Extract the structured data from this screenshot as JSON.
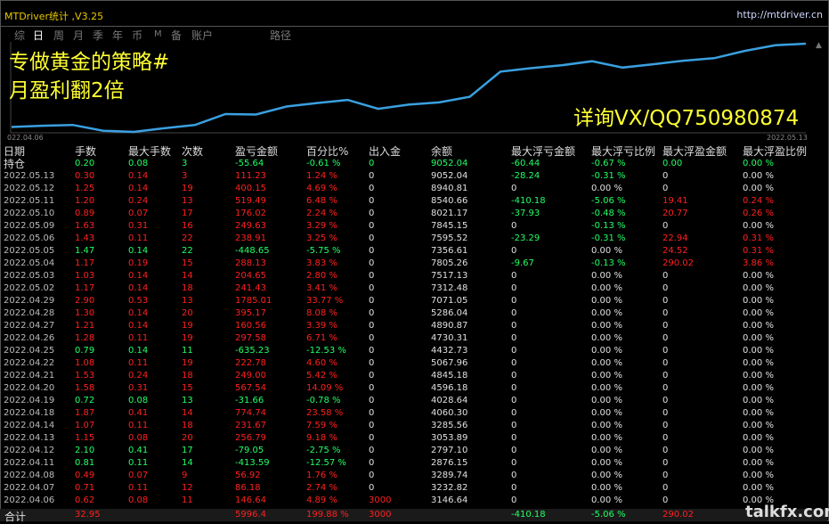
{
  "window": {
    "title": "MTDriver统计 ,V3.25",
    "url": "http://mtdriver.cn"
  },
  "tabs": [
    "综",
    "日",
    "周",
    "月",
    "季",
    "年",
    "币",
    "M",
    "备",
    "账户",
    "路径"
  ],
  "active_tab": "日",
  "overlay": {
    "line1": "专做黄金的策略#",
    "line2": "月盈利翻2倍",
    "line3": "详询VX/QQ750980874"
  },
  "chart_labels": {
    "start": "022.04.06",
    "end": "2022.05.13"
  },
  "chart_data": {
    "type": "line",
    "x": [
      "2022.04.06",
      "2022.04.07",
      "2022.04.08",
      "2022.04.11",
      "2022.04.12",
      "2022.04.13",
      "2022.04.14",
      "2022.04.18",
      "2022.04.19",
      "2022.04.20",
      "2022.04.21",
      "2022.04.22",
      "2022.04.25",
      "2022.04.26",
      "2022.04.27",
      "2022.04.28",
      "2022.04.29",
      "2022.05.02",
      "2022.05.03",
      "2022.05.04",
      "2022.05.05",
      "2022.05.06",
      "2022.05.09",
      "2022.05.10",
      "2022.05.11",
      "2022.05.12",
      "2022.05.13"
    ],
    "values": [
      3146.64,
      3232.82,
      3289.74,
      2876.15,
      2797.1,
      3053.89,
      3285.56,
      4060.3,
      4028.64,
      4596.18,
      4845.18,
      5067.96,
      4432.73,
      4730.31,
      4890.87,
      5286.04,
      7071.05,
      7312.48,
      7517.13,
      7805.26,
      7356.61,
      7595.52,
      7845.15,
      8021.17,
      8540.66,
      8940.81,
      9052.04
    ],
    "color": "#3aa0e0"
  },
  "columns": [
    "日期",
    "手数",
    "最大手数",
    "次数",
    "盈亏金额",
    "百分比%",
    "出入金",
    "余额",
    "最大浮亏金额",
    "最大浮亏比例",
    "最大浮盈金额",
    "最大浮盈比例"
  ],
  "holding": {
    "date": "持仓",
    "lots": "0.20",
    "maxlots": "0.08",
    "count": "3",
    "pnl": "-55.64",
    "pct": "-0.61 %",
    "io": "0",
    "bal": "9052.04",
    "mfl": "-60.44",
    "mflp": "-0.67 %",
    "mfp": "0.00",
    "mfpp": "0.00 %"
  },
  "rows": [
    {
      "date": "2022.05.13",
      "lots": "0.30",
      "maxlots": "0.14",
      "count": "3",
      "pnl": "111.23",
      "pct": "1.24 %",
      "io": "0",
      "bal": "9052.04",
      "mfl": "-28.24",
      "mflp": "-0.31 %",
      "mfp": "0",
      "mfpp": "0.00 %",
      "c": "r"
    },
    {
      "date": "2022.05.12",
      "lots": "1.25",
      "maxlots": "0.14",
      "count": "19",
      "pnl": "400.15",
      "pct": "4.69 %",
      "io": "0",
      "bal": "8940.81",
      "mfl": "0",
      "mflp": "0.00 %",
      "mfp": "0",
      "mfpp": "0.00 %",
      "c": "r"
    },
    {
      "date": "2022.05.11",
      "lots": "1.20",
      "maxlots": "0.24",
      "count": "13",
      "pnl": "519.49",
      "pct": "6.48 %",
      "io": "0",
      "bal": "8540.66",
      "mfl": "-410.18",
      "mflp": "-5.06 %",
      "mfp": "19.41",
      "mfpp": "0.24 %",
      "c": "r"
    },
    {
      "date": "2022.05.10",
      "lots": "0.89",
      "maxlots": "0.07",
      "count": "17",
      "pnl": "176.02",
      "pct": "2.24 %",
      "io": "0",
      "bal": "8021.17",
      "mfl": "-37.93",
      "mflp": "-0.48 %",
      "mfp": "20.77",
      "mfpp": "0.26 %",
      "c": "r"
    },
    {
      "date": "2022.05.09",
      "lots": "1.63",
      "maxlots": "0.31",
      "count": "16",
      "pnl": "249.63",
      "pct": "3.29 %",
      "io": "0",
      "bal": "7845.15",
      "mfl": "0",
      "mflp": "-0.13 %",
      "mfp": "0",
      "mfpp": "0.00 %",
      "c": "r"
    },
    {
      "date": "2022.05.06",
      "lots": "1.43",
      "maxlots": "0.11",
      "count": "22",
      "pnl": "238.91",
      "pct": "3.25 %",
      "io": "0",
      "bal": "7595.52",
      "mfl": "-23.29",
      "mflp": "-0.31 %",
      "mfp": "22.94",
      "mfpp": "0.31 %",
      "c": "r"
    },
    {
      "date": "2022.05.05",
      "lots": "1.47",
      "maxlots": "0.14",
      "count": "22",
      "pnl": "-448.65",
      "pct": "-5.75 %",
      "io": "0",
      "bal": "7356.61",
      "mfl": "0",
      "mflp": "0.00 %",
      "mfp": "24.52",
      "mfpp": "0.31 %",
      "c": "g"
    },
    {
      "date": "2022.05.04",
      "lots": "1.17",
      "maxlots": "0.19",
      "count": "15",
      "pnl": "288.13",
      "pct": "3.83 %",
      "io": "0",
      "bal": "7805.26",
      "mfl": "-9.67",
      "mflp": "-0.13 %",
      "mfp": "290.02",
      "mfpp": "3.86 %",
      "c": "r"
    },
    {
      "date": "2022.05.03",
      "lots": "1.03",
      "maxlots": "0.14",
      "count": "14",
      "pnl": "204.65",
      "pct": "2.80 %",
      "io": "0",
      "bal": "7517.13",
      "mfl": "0",
      "mflp": "0.00 %",
      "mfp": "0",
      "mfpp": "0.00 %",
      "c": "r"
    },
    {
      "date": "2022.05.02",
      "lots": "1.17",
      "maxlots": "0.14",
      "count": "18",
      "pnl": "241.43",
      "pct": "3.41 %",
      "io": "0",
      "bal": "7312.48",
      "mfl": "0",
      "mflp": "0.00 %",
      "mfp": "0",
      "mfpp": "0.00 %",
      "c": "r"
    },
    {
      "date": "2022.04.29",
      "lots": "2.90",
      "maxlots": "0.53",
      "count": "13",
      "pnl": "1785.01",
      "pct": "33.77 %",
      "io": "0",
      "bal": "7071.05",
      "mfl": "0",
      "mflp": "0.00 %",
      "mfp": "0",
      "mfpp": "0.00 %",
      "c": "r"
    },
    {
      "date": "2022.04.28",
      "lots": "1.30",
      "maxlots": "0.14",
      "count": "20",
      "pnl": "395.17",
      "pct": "8.08 %",
      "io": "0",
      "bal": "5286.04",
      "mfl": "0",
      "mflp": "0.00 %",
      "mfp": "0",
      "mfpp": "0.00 %",
      "c": "r"
    },
    {
      "date": "2022.04.27",
      "lots": "1.21",
      "maxlots": "0.14",
      "count": "19",
      "pnl": "160.56",
      "pct": "3.39 %",
      "io": "0",
      "bal": "4890.87",
      "mfl": "0",
      "mflp": "0.00 %",
      "mfp": "0",
      "mfpp": "0.00 %",
      "c": "r"
    },
    {
      "date": "2022.04.26",
      "lots": "1.28",
      "maxlots": "0.11",
      "count": "19",
      "pnl": "297.58",
      "pct": "6.71 %",
      "io": "0",
      "bal": "4730.31",
      "mfl": "0",
      "mflp": "0.00 %",
      "mfp": "0",
      "mfpp": "0.00 %",
      "c": "r"
    },
    {
      "date": "2022.04.25",
      "lots": "0.79",
      "maxlots": "0.14",
      "count": "11",
      "pnl": "-635.23",
      "pct": "-12.53 %",
      "io": "0",
      "bal": "4432.73",
      "mfl": "0",
      "mflp": "0.00 %",
      "mfp": "0",
      "mfpp": "0.00 %",
      "c": "g"
    },
    {
      "date": "2022.04.22",
      "lots": "1.08",
      "maxlots": "0.11",
      "count": "19",
      "pnl": "222.78",
      "pct": "4.60 %",
      "io": "0",
      "bal": "5067.96",
      "mfl": "0",
      "mflp": "0.00 %",
      "mfp": "0",
      "mfpp": "0.00 %",
      "c": "r"
    },
    {
      "date": "2022.04.21",
      "lots": "1.53",
      "maxlots": "0.24",
      "count": "18",
      "pnl": "249.00",
      "pct": "5.42 %",
      "io": "0",
      "bal": "4845.18",
      "mfl": "0",
      "mflp": "0.00 %",
      "mfp": "0",
      "mfpp": "0.00 %",
      "c": "r"
    },
    {
      "date": "2022.04.20",
      "lots": "1.58",
      "maxlots": "0.31",
      "count": "15",
      "pnl": "567.54",
      "pct": "14.09 %",
      "io": "0",
      "bal": "4596.18",
      "mfl": "0",
      "mflp": "0.00 %",
      "mfp": "0",
      "mfpp": "0.00 %",
      "c": "r"
    },
    {
      "date": "2022.04.19",
      "lots": "0.72",
      "maxlots": "0.08",
      "count": "13",
      "pnl": "-31.66",
      "pct": "-0.78 %",
      "io": "0",
      "bal": "4028.64",
      "mfl": "0",
      "mflp": "0.00 %",
      "mfp": "0",
      "mfpp": "0.00 %",
      "c": "g"
    },
    {
      "date": "2022.04.18",
      "lots": "1.87",
      "maxlots": "0.41",
      "count": "14",
      "pnl": "774.74",
      "pct": "23.58 %",
      "io": "0",
      "bal": "4060.30",
      "mfl": "0",
      "mflp": "0.00 %",
      "mfp": "0",
      "mfpp": "0.00 %",
      "c": "r"
    },
    {
      "date": "2022.04.14",
      "lots": "1.07",
      "maxlots": "0.11",
      "count": "18",
      "pnl": "231.67",
      "pct": "7.59 %",
      "io": "0",
      "bal": "3285.56",
      "mfl": "0",
      "mflp": "0.00 %",
      "mfp": "0",
      "mfpp": "0.00 %",
      "c": "r"
    },
    {
      "date": "2022.04.13",
      "lots": "1.15",
      "maxlots": "0.08",
      "count": "20",
      "pnl": "256.79",
      "pct": "9.18 %",
      "io": "0",
      "bal": "3053.89",
      "mfl": "0",
      "mflp": "0.00 %",
      "mfp": "0",
      "mfpp": "0.00 %",
      "c": "r"
    },
    {
      "date": "2022.04.12",
      "lots": "2.10",
      "maxlots": "0.41",
      "count": "17",
      "pnl": "-79.05",
      "pct": "-2.75 %",
      "io": "0",
      "bal": "2797.10",
      "mfl": "0",
      "mflp": "0.00 %",
      "mfp": "0",
      "mfpp": "0.00 %",
      "c": "g"
    },
    {
      "date": "2022.04.11",
      "lots": "0.81",
      "maxlots": "0.11",
      "count": "14",
      "pnl": "-413.59",
      "pct": "-12.57 %",
      "io": "0",
      "bal": "2876.15",
      "mfl": "0",
      "mflp": "0.00 %",
      "mfp": "0",
      "mfpp": "0.00 %",
      "c": "g"
    },
    {
      "date": "2022.04.08",
      "lots": "0.49",
      "maxlots": "0.07",
      "count": "9",
      "pnl": "56.92",
      "pct": "1.76 %",
      "io": "0",
      "bal": "3289.74",
      "mfl": "0",
      "mflp": "0.00 %",
      "mfp": "0",
      "mfpp": "0.00 %",
      "c": "r"
    },
    {
      "date": "2022.04.07",
      "lots": "0.71",
      "maxlots": "0.11",
      "count": "12",
      "pnl": "86.18",
      "pct": "2.74 %",
      "io": "0",
      "bal": "3232.82",
      "mfl": "0",
      "mflp": "0.00 %",
      "mfp": "0",
      "mfpp": "0.00 %",
      "c": "r"
    },
    {
      "date": "2022.04.06",
      "lots": "0.62",
      "maxlots": "0.08",
      "count": "11",
      "pnl": "146.64",
      "pct": "4.89 %",
      "io": "3000",
      "bal": "3146.64",
      "mfl": "0",
      "mflp": "0.00 %",
      "mfp": "0",
      "mfpp": "0.00 %",
      "c": "r"
    }
  ],
  "total": {
    "label": "合计",
    "lots": "32.95",
    "pnl": "5996.4",
    "pct": "199.88 %",
    "io": "3000",
    "mfl": "-410.18",
    "mflp": "-5.06 %",
    "mfp": "290.02"
  },
  "watermark": "talkfx.com"
}
